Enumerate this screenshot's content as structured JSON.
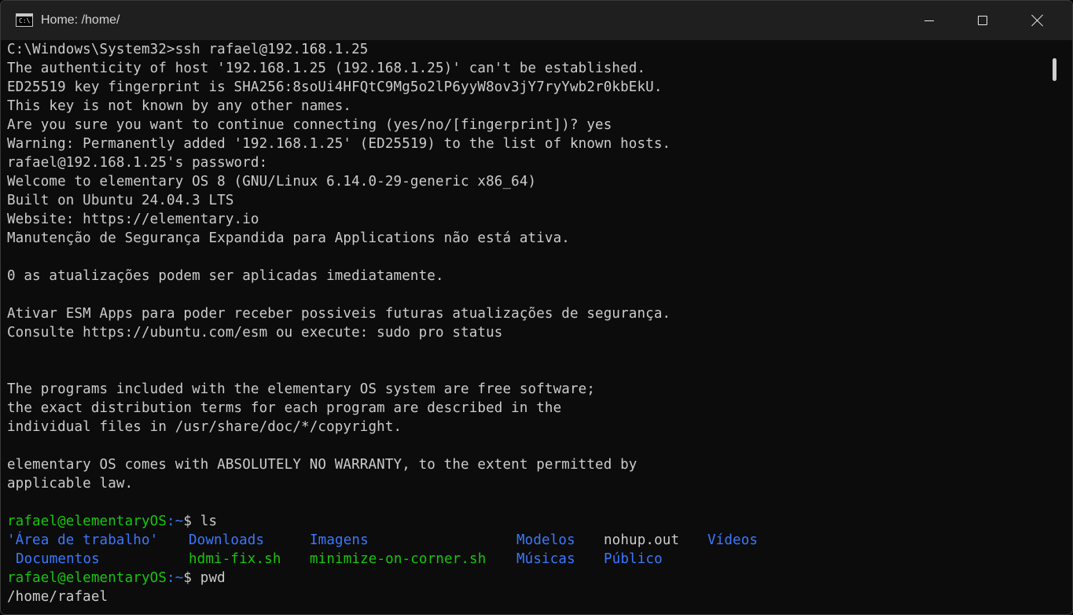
{
  "window": {
    "title": "Home: /home/",
    "icon": "cmd-icon",
    "icon_glyph": "C:\\"
  },
  "terminal": {
    "lines": [
      "C:\\Windows\\System32>ssh rafael@192.168.1.25",
      "The authenticity of host '192.168.1.25 (192.168.1.25)' can't be established.",
      "ED25519 key fingerprint is SHA256:8soUi4HFQtC9Mg5o2lP6yyW8ov3jY7ryYwb2r0kbEkU.",
      "This key is not known by any other names.",
      "Are you sure you want to continue connecting (yes/no/[fingerprint])? yes",
      "Warning: Permanently added '192.168.1.25' (ED25519) to the list of known hosts.",
      "rafael@192.168.1.25's password:",
      "Welcome to elementary OS 8 (GNU/Linux 6.14.0-29-generic x86_64)",
      "Built on Ubuntu 24.04.3 LTS",
      "Website: https://elementary.io",
      "Manutenção de Segurança Expandida para Applications não está ativa.",
      "",
      "0 as atualizações podem ser aplicadas imediatamente.",
      "",
      "Ativar ESM Apps para poder receber possiveis futuras atualizações de segurança.",
      "Consulte https://ubuntu.com/esm ou execute: sudo pro status",
      "",
      "",
      "The programs included with the elementary OS system are free software;",
      "the exact distribution terms for each program are described in the",
      "individual files in /usr/share/doc/*/copyright.",
      "",
      "elementary OS comes with ABSOLUTELY NO WARRANTY, to the extent permitted by",
      "applicable law.",
      ""
    ],
    "prompt1": {
      "user_host": "rafael@elementaryOS",
      "path": ":~",
      "symbol": "$ ",
      "command": "ls"
    },
    "ls_row1": [
      {
        "name": "'Área de trabalho'",
        "color": "blue"
      },
      {
        "name": "Downloads",
        "color": "blue"
      },
      {
        "name": "Imagens",
        "color": "blue"
      },
      {
        "name": "Modelos",
        "color": "blue"
      },
      {
        "name": "nohup.out",
        "color": "white"
      },
      {
        "name": "Vídeos",
        "color": "blue"
      }
    ],
    "ls_row2": [
      {
        "name": "Documentos",
        "color": "blue"
      },
      {
        "name": "hdmi-fix.sh",
        "color": "green"
      },
      {
        "name": "minimize-on-corner.sh",
        "color": "green"
      },
      {
        "name": "Músicas",
        "color": "blue"
      },
      {
        "name": "Público",
        "color": "blue"
      }
    ],
    "prompt2": {
      "user_host": "rafael@elementaryOS",
      "path": ":~",
      "symbol": "$ ",
      "command": "pwd"
    },
    "output_pwd": "/home/rafael"
  },
  "colors": {
    "background": "#0c0c0c",
    "text": "#cccccc",
    "green": "#16c60c",
    "blue": "#3b78ff",
    "titlebar": "#1f1f1f"
  }
}
